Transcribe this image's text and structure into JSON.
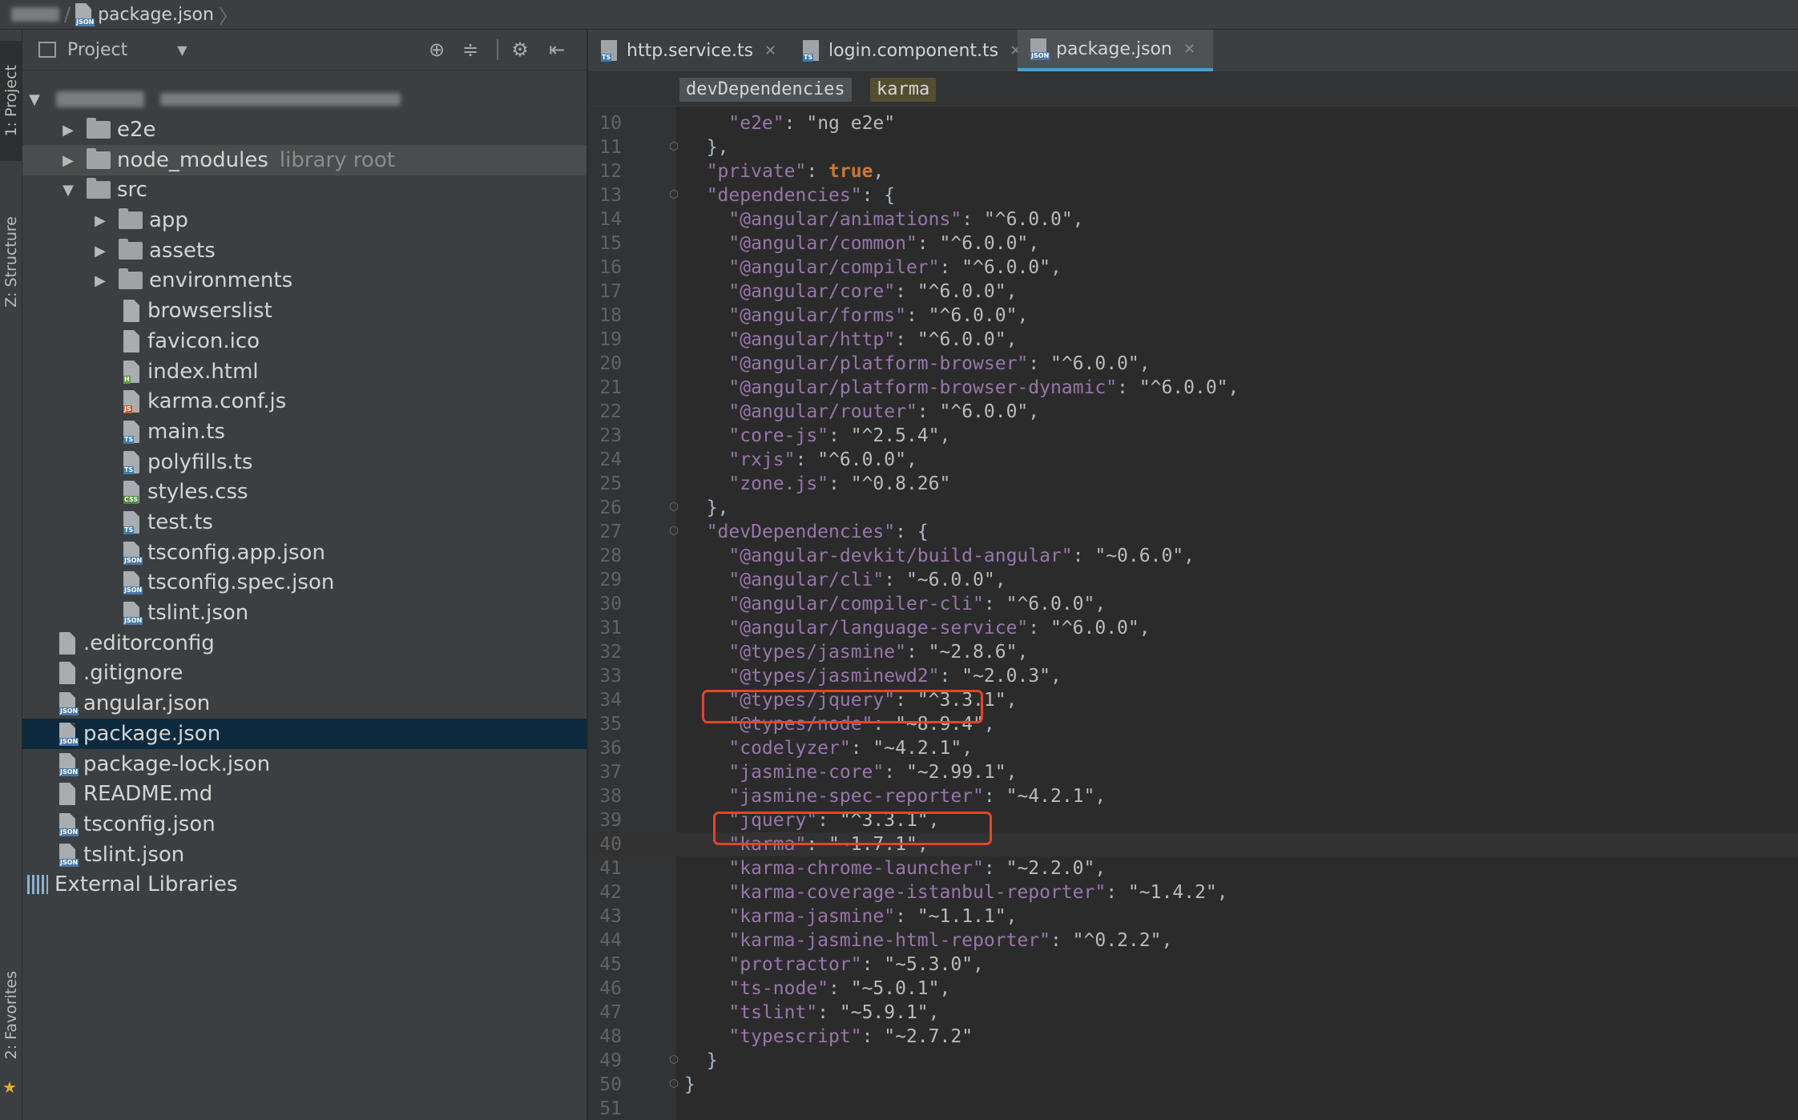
{
  "navbar": {
    "file": "package.json"
  },
  "toolstrip": {
    "project_tab": "1: Project",
    "structure_tab": "Z: Structure",
    "favorites_tab": "2: Favorites"
  },
  "project": {
    "title": "Project",
    "items": [
      {
        "label": "e2e",
        "kind": "folder",
        "arrow": "▶"
      },
      {
        "label": "node_modules",
        "kind": "folder",
        "arrow": "▶",
        "note": "library root"
      },
      {
        "label": "src",
        "kind": "folder",
        "arrow": "▼"
      },
      {
        "label": "app",
        "kind": "folder",
        "arrow": "▶"
      },
      {
        "label": "assets",
        "kind": "folder",
        "arrow": "▶"
      },
      {
        "label": "environments",
        "kind": "folder",
        "arrow": "▶"
      },
      {
        "label": "browserslist",
        "kind": "file"
      },
      {
        "label": "favicon.ico",
        "kind": "file",
        "badge": "ico"
      },
      {
        "label": "index.html",
        "kind": "file",
        "badge": "H"
      },
      {
        "label": "karma.conf.js",
        "kind": "file",
        "badge": "JS"
      },
      {
        "label": "main.ts",
        "kind": "file",
        "badge": "TS"
      },
      {
        "label": "polyfills.ts",
        "kind": "file",
        "badge": "TS"
      },
      {
        "label": "styles.css",
        "kind": "file",
        "badge": "CSS"
      },
      {
        "label": "test.ts",
        "kind": "file",
        "badge": "TS"
      },
      {
        "label": "tsconfig.app.json",
        "kind": "file",
        "badge": "JSON"
      },
      {
        "label": "tsconfig.spec.json",
        "kind": "file",
        "badge": "JSON"
      },
      {
        "label": "tslint.json",
        "kind": "file",
        "badge": "JSON"
      },
      {
        "label": ".editorconfig",
        "kind": "file"
      },
      {
        "label": ".gitignore",
        "kind": "file"
      },
      {
        "label": "angular.json",
        "kind": "file",
        "badge": "JSON"
      },
      {
        "label": "package.json",
        "kind": "file",
        "badge": "JSON",
        "selected": true
      },
      {
        "label": "package-lock.json",
        "kind": "file",
        "badge": "JSON"
      },
      {
        "label": "README.md",
        "kind": "file"
      },
      {
        "label": "tsconfig.json",
        "kind": "file",
        "badge": "JSON"
      },
      {
        "label": "tslint.json",
        "kind": "file",
        "badge": "JSON"
      },
      {
        "label": "External Libraries",
        "kind": "libs"
      }
    ]
  },
  "editor": {
    "tabs": [
      {
        "label": "http.service.ts",
        "badge": "TS"
      },
      {
        "label": "login.component.ts",
        "badge": "TS"
      },
      {
        "label": "package.json",
        "badge": "JSON",
        "active": true
      }
    ],
    "breadcrumbs": [
      "devDependencies",
      "karma"
    ],
    "lines": [
      {
        "n": "10",
        "text": "    \"e2e\": \"ng e2e\""
      },
      {
        "n": "11",
        "text": "  },"
      },
      {
        "n": "12",
        "text": "  \"private\": true,"
      },
      {
        "n": "13",
        "text": "  \"dependencies\": {"
      },
      {
        "n": "14",
        "text": "    \"@angular/animations\": \"^6.0.0\","
      },
      {
        "n": "15",
        "text": "    \"@angular/common\": \"^6.0.0\","
      },
      {
        "n": "16",
        "text": "    \"@angular/compiler\": \"^6.0.0\","
      },
      {
        "n": "17",
        "text": "    \"@angular/core\": \"^6.0.0\","
      },
      {
        "n": "18",
        "text": "    \"@angular/forms\": \"^6.0.0\","
      },
      {
        "n": "19",
        "text": "    \"@angular/http\": \"^6.0.0\","
      },
      {
        "n": "20",
        "text": "    \"@angular/platform-browser\": \"^6.0.0\","
      },
      {
        "n": "21",
        "text": "    \"@angular/platform-browser-dynamic\": \"^6.0.0\","
      },
      {
        "n": "22",
        "text": "    \"@angular/router\": \"^6.0.0\","
      },
      {
        "n": "23",
        "text": "    \"core-js\": \"^2.5.4\","
      },
      {
        "n": "24",
        "text": "    \"rxjs\": \"^6.0.0\","
      },
      {
        "n": "25",
        "text": "    \"zone.js\": \"^0.8.26\""
      },
      {
        "n": "26",
        "text": "  },"
      },
      {
        "n": "27",
        "text": "  \"devDependencies\": {"
      },
      {
        "n": "28",
        "text": "    \"@angular-devkit/build-angular\": \"~0.6.0\","
      },
      {
        "n": "29",
        "text": "    \"@angular/cli\": \"~6.0.0\","
      },
      {
        "n": "30",
        "text": "    \"@angular/compiler-cli\": \"^6.0.0\","
      },
      {
        "n": "31",
        "text": "    \"@angular/language-service\": \"^6.0.0\","
      },
      {
        "n": "32",
        "text": "    \"@types/jasmine\": \"~2.8.6\","
      },
      {
        "n": "33",
        "text": "    \"@types/jasminewd2\": \"~2.0.3\","
      },
      {
        "n": "34",
        "text": "    \"@types/jquery\": \"^3.3.1\","
      },
      {
        "n": "35",
        "text": "    \"@types/node\": \"~8.9.4\","
      },
      {
        "n": "36",
        "text": "    \"codelyzer\": \"~4.2.1\","
      },
      {
        "n": "37",
        "text": "    \"jasmine-core\": \"~2.99.1\","
      },
      {
        "n": "38",
        "text": "    \"jasmine-spec-reporter\": \"~4.2.1\","
      },
      {
        "n": "39",
        "text": "    \"jquery\": \"^3.3.1\","
      },
      {
        "n": "40",
        "text": "    \"karma\": \"~1.7.1\","
      },
      {
        "n": "41",
        "text": "    \"karma-chrome-launcher\": \"~2.2.0\","
      },
      {
        "n": "42",
        "text": "    \"karma-coverage-istanbul-reporter\": \"~1.4.2\","
      },
      {
        "n": "43",
        "text": "    \"karma-jasmine\": \"~1.1.1\","
      },
      {
        "n": "44",
        "text": "    \"karma-jasmine-html-reporter\": \"^0.2.2\","
      },
      {
        "n": "45",
        "text": "    \"protractor\": \"~5.3.0\","
      },
      {
        "n": "46",
        "text": "    \"ts-node\": \"~5.0.1\","
      },
      {
        "n": "47",
        "text": "    \"tslint\": \"~5.9.1\","
      },
      {
        "n": "48",
        "text": "    \"typescript\": \"~2.7.2\""
      },
      {
        "n": "49",
        "text": "  }"
      },
      {
        "n": "50",
        "text": "}"
      },
      {
        "n": "51",
        "text": ""
      }
    ]
  }
}
